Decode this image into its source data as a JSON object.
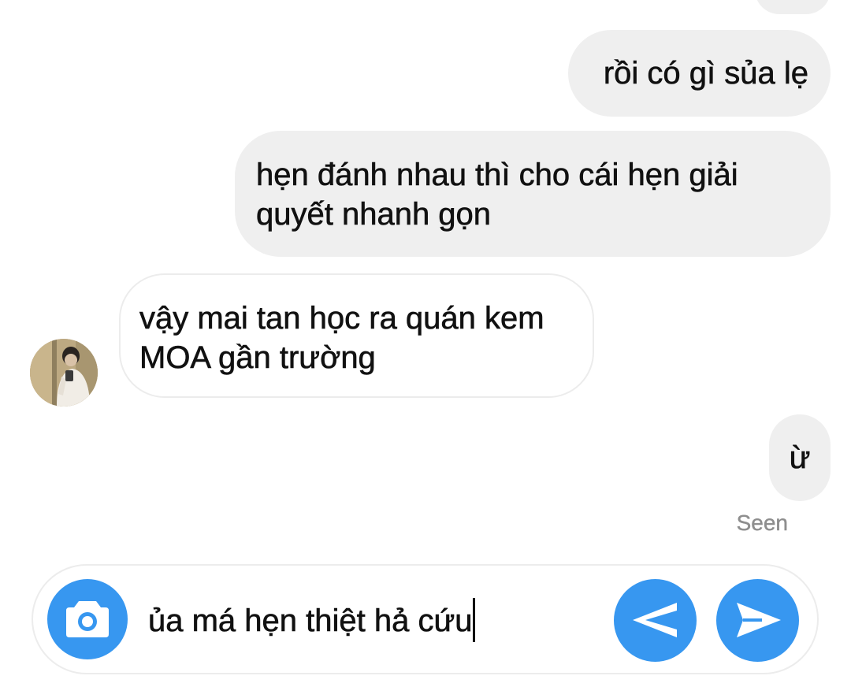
{
  "conversation": {
    "messages": [
      {
        "sender": "me",
        "text": "rồi có gì sủa lẹ"
      },
      {
        "sender": "me",
        "text": "hẹn đánh nhau thì cho cái hẹn giải quyết nhanh gọn"
      },
      {
        "sender": "them",
        "text": "vậy mai tan học ra quán kem MOA gần trường"
      },
      {
        "sender": "me",
        "text": "ừ"
      }
    ],
    "status": "Seen"
  },
  "composer": {
    "input_value": "ủa má hẹn thiệt hả cứu",
    "camera_icon": "camera-icon",
    "back_icon": "arrow-left-icon",
    "send_icon": "send-icon"
  },
  "colors": {
    "accent": "#3797f0",
    "outgoing_bubble": "#efefef",
    "incoming_border": "#ececec",
    "text": "#111111",
    "seen": "#8e8e8e"
  }
}
